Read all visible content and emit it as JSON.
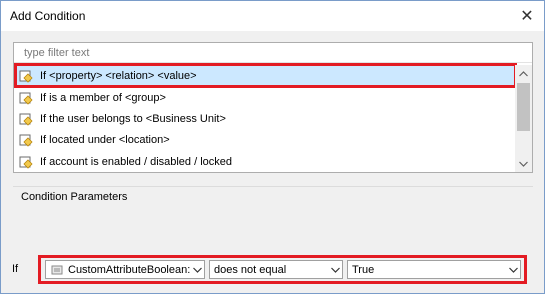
{
  "window": {
    "title": "Add Condition",
    "close_glyph": "✕"
  },
  "list": {
    "filter_placeholder": "type filter text",
    "items": [
      {
        "label": "If <property> <relation> <value>",
        "icon": "condition-icon",
        "selected": true
      },
      {
        "label": "If is a member of <group>",
        "icon": "condition-icon",
        "selected": false
      },
      {
        "label": "If the user belongs to <Business Unit>",
        "icon": "condition-icon",
        "selected": false
      },
      {
        "label": "If located under <location>",
        "icon": "condition-icon",
        "selected": false
      },
      {
        "label": "If account is enabled / disabled / locked",
        "icon": "condition-icon",
        "selected": false
      }
    ]
  },
  "parameters": {
    "title": "Condition Parameters",
    "if_label": "If",
    "property": {
      "value": "CustomAttributeBoolean:",
      "icon": "attribute-icon"
    },
    "relation": {
      "value": "does not equal"
    },
    "value": {
      "value": "True"
    }
  },
  "colors": {
    "highlight": "#e31b23",
    "selection": "#cce8ff"
  }
}
